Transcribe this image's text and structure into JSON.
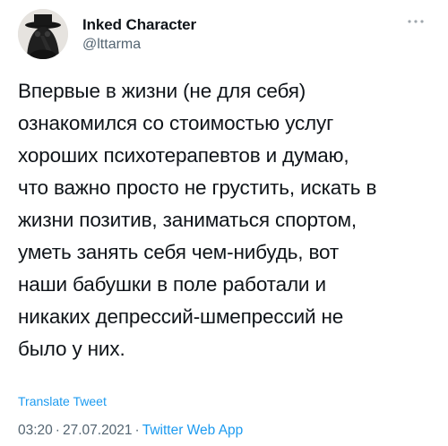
{
  "author": {
    "name": "Inked Character",
    "handle": "@lttarma",
    "avatar_icon": "plague-doctor-avatar-icon"
  },
  "more_icon": "more-options-icon",
  "tweet": {
    "text": "Впервые в жизни (не для себя)\nознакомился со стоимостью услуг\nхороших психотерапевтов и думаю,\nчто важно просто не грустить, искать в\nжизни позитив, заниматься спортом,\nуметь занять себя чем-нибудь, вот\nнаши бабушки в поле работали и\nникаких депрессий-шмепрессий не\nбыло у них."
  },
  "translate_label": "Translate Tweet",
  "meta": {
    "time": "03:20",
    "separator": "·",
    "date": "27.07.2021",
    "source": "Twitter Web App"
  },
  "colors": {
    "link": "#1d9bf0",
    "secondary_text": "#536471",
    "primary_text": "#0f1419"
  }
}
